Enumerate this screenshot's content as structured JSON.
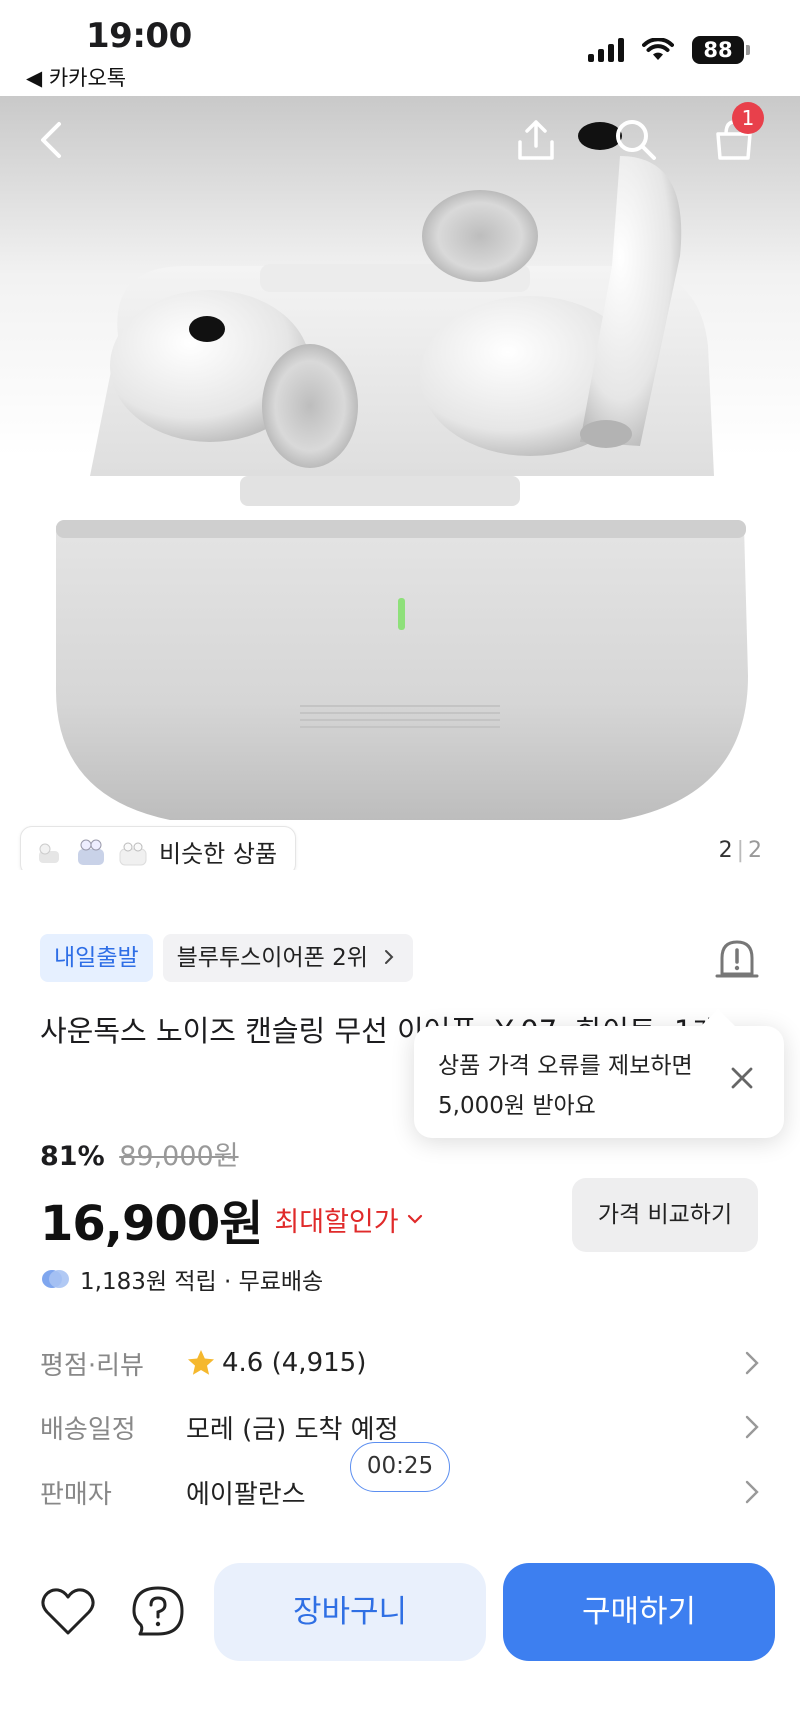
{
  "status_bar": {
    "time": "19:00",
    "back_app": "◀ 카카오톡",
    "battery": "88"
  },
  "hero": {
    "cart_count": "1",
    "similar_label": "비슷한 상품",
    "page_current": "2",
    "page_sep": "|",
    "page_total": "2"
  },
  "product": {
    "tag_fast": "내일출발",
    "tag_rank": "블루투스이어폰 2위",
    "title": "사운독스 노이즈 캔슬링 무선 이어폰, Y-07, 화이트, 1개",
    "discount_rate": "81%",
    "original_price": "89,000원",
    "price": "16,900원",
    "max_discount_label": "최대할인가",
    "compare_button": "가격 비교하기",
    "points_text": "1,183원 적립 · 무료배송"
  },
  "tooltip": {
    "text": "상품 가격 오류를 제보하면 5,000원 받아요"
  },
  "info_rows": {
    "rating_label": "평점·리뷰",
    "rating_value": "4.6 (4,915)",
    "delivery_label": "배송일정",
    "delivery_value": "모레 (금) 도착 예정",
    "seller_label": "판매자",
    "seller_value": "에이팔란스"
  },
  "timer": "00:25",
  "bottom_bar": {
    "cart_label": "장바구니",
    "buy_label": "구매하기"
  },
  "colors": {
    "accent_blue": "#3d7ff0",
    "discount_red": "#e02a2a",
    "badge_red": "#e8404b",
    "star_yellow": "#f5b82e"
  }
}
